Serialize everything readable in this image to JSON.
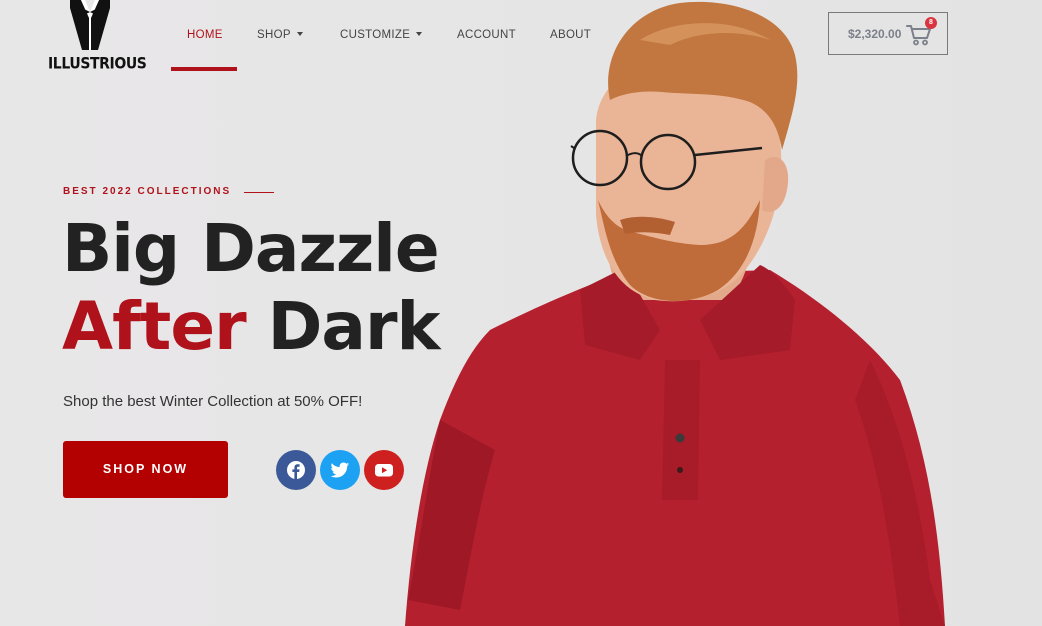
{
  "brand": {
    "name": "ILLUSTRIOUS",
    "logo_icon": "tuxedo-icon"
  },
  "nav": {
    "items": [
      {
        "label": "HOME",
        "active": true,
        "dropdown": false
      },
      {
        "label": "SHOP",
        "active": false,
        "dropdown": true
      },
      {
        "label": "CUSTOMIZE",
        "active": false,
        "dropdown": true
      },
      {
        "label": "ACCOUNT",
        "active": false,
        "dropdown": false
      },
      {
        "label": "ABOUT",
        "active": false,
        "dropdown": false
      }
    ]
  },
  "cart": {
    "total": "$2,320.00",
    "count": "8",
    "icon": "cart-icon"
  },
  "hero": {
    "eyebrow": "BEST 2022 COLLECTIONS",
    "headline_line1": "Big Dazzle",
    "headline_accent": "After",
    "headline_rest": " Dark",
    "subtitle": "Shop the best Winter Collection at 50% OFF!",
    "cta_label": "SHOP NOW"
  },
  "social": [
    {
      "name": "facebook",
      "icon": "facebook-icon"
    },
    {
      "name": "twitter",
      "icon": "twitter-icon"
    },
    {
      "name": "youtube",
      "icon": "youtube-icon"
    }
  ],
  "colors": {
    "accent": "#b0121b",
    "button": "#b30000",
    "background": "#e8e7e8",
    "facebook": "#3b5998",
    "twitter": "#1da1f2",
    "youtube": "#cd201f"
  }
}
